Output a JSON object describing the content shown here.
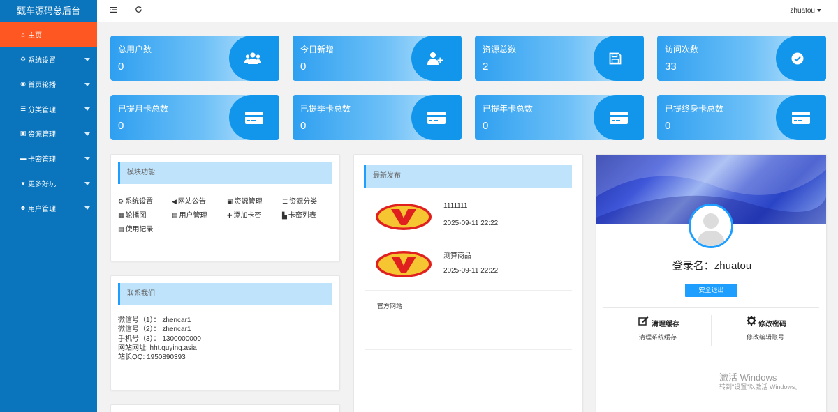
{
  "sidebar": {
    "brand": "甄车源码总后台",
    "items": [
      {
        "label": "主页",
        "icon": "home-icon",
        "glyph": "⌂",
        "active": true,
        "caret": false
      },
      {
        "label": "系统设置",
        "icon": "gear-icon",
        "glyph": "⚙",
        "active": false,
        "caret": true
      },
      {
        "label": "首页轮播",
        "icon": "eye-icon",
        "glyph": "◉",
        "active": false,
        "caret": true
      },
      {
        "label": "分类管理",
        "icon": "list-icon",
        "glyph": "☰",
        "active": false,
        "caret": true
      },
      {
        "label": "资源管理",
        "icon": "save-icon",
        "glyph": "▣",
        "active": false,
        "caret": true
      },
      {
        "label": "卡密管理",
        "icon": "card-icon",
        "glyph": "▬",
        "active": false,
        "caret": true
      },
      {
        "label": "更多好玩",
        "icon": "heart-icon",
        "glyph": "♥",
        "active": false,
        "caret": true
      },
      {
        "label": "用户管理",
        "icon": "users-icon",
        "glyph": "☻",
        "active": false,
        "caret": true
      }
    ]
  },
  "header": {
    "username": "zhuatou"
  },
  "stats_row1": [
    {
      "label": "总用户数",
      "value": "0",
      "icon": "users-icon"
    },
    {
      "label": "今日新增",
      "value": "0",
      "icon": "user-plus-icon"
    },
    {
      "label": "资源总数",
      "value": "2",
      "icon": "save-icon"
    },
    {
      "label": "访问次数",
      "value": "33",
      "icon": "check-circle-icon"
    }
  ],
  "stats_row2": [
    {
      "label": "已提月卡总数",
      "value": "0",
      "icon": "card-icon"
    },
    {
      "label": "已提季卡总数",
      "value": "0",
      "icon": "card-icon"
    },
    {
      "label": "已提年卡总数",
      "value": "0",
      "icon": "card-icon"
    },
    {
      "label": "已提终身卡总数",
      "value": "0",
      "icon": "card-icon"
    }
  ],
  "modules": {
    "title": "模块功能",
    "items": [
      {
        "label": "系统设置",
        "glyph": "⚙"
      },
      {
        "label": "网站公告",
        "glyph": "◀"
      },
      {
        "label": "资源管理",
        "glyph": "▣"
      },
      {
        "label": "资源分类",
        "glyph": "☰"
      },
      {
        "label": "轮播图",
        "glyph": "▦"
      },
      {
        "label": "用户管理",
        "glyph": "▤"
      },
      {
        "label": "添加卡密",
        "glyph": "✚"
      },
      {
        "label": "卡密列表",
        "glyph": "▙"
      },
      {
        "label": "使用记录",
        "glyph": "▤"
      }
    ]
  },
  "contact": {
    "title": "联系我们",
    "lines": [
      "微信号（1）：  zhencar1",
      "微信号（2）：  zhencar1",
      "手机号（3）：  1300000000",
      "网站网址:   hht.quying.asia",
      "站长QQ:   1950890393"
    ]
  },
  "news": {
    "title": "最新发布",
    "items": [
      {
        "title": "1111111",
        "date": "2025-09-11 22:22"
      },
      {
        "title": "测算商品",
        "date": "2025-09-11 22:22"
      }
    ],
    "official_site": "官方网站"
  },
  "profile": {
    "login_name": "登录名：zhuatou",
    "logout_label": "安全退出",
    "clear_cache_title": "清理缓存",
    "clear_cache_sub": "清理系统缓存",
    "change_pwd_title": "修改密码",
    "change_pwd_sub": "修改编辑账号"
  },
  "watermark": {
    "line1": "激活 Windows",
    "line2": "转到\"设置\"以激活 Windows。"
  },
  "colors": {
    "sidebar": "#0a74bd",
    "active": "#ff5722",
    "accent": "#1e9fff"
  }
}
